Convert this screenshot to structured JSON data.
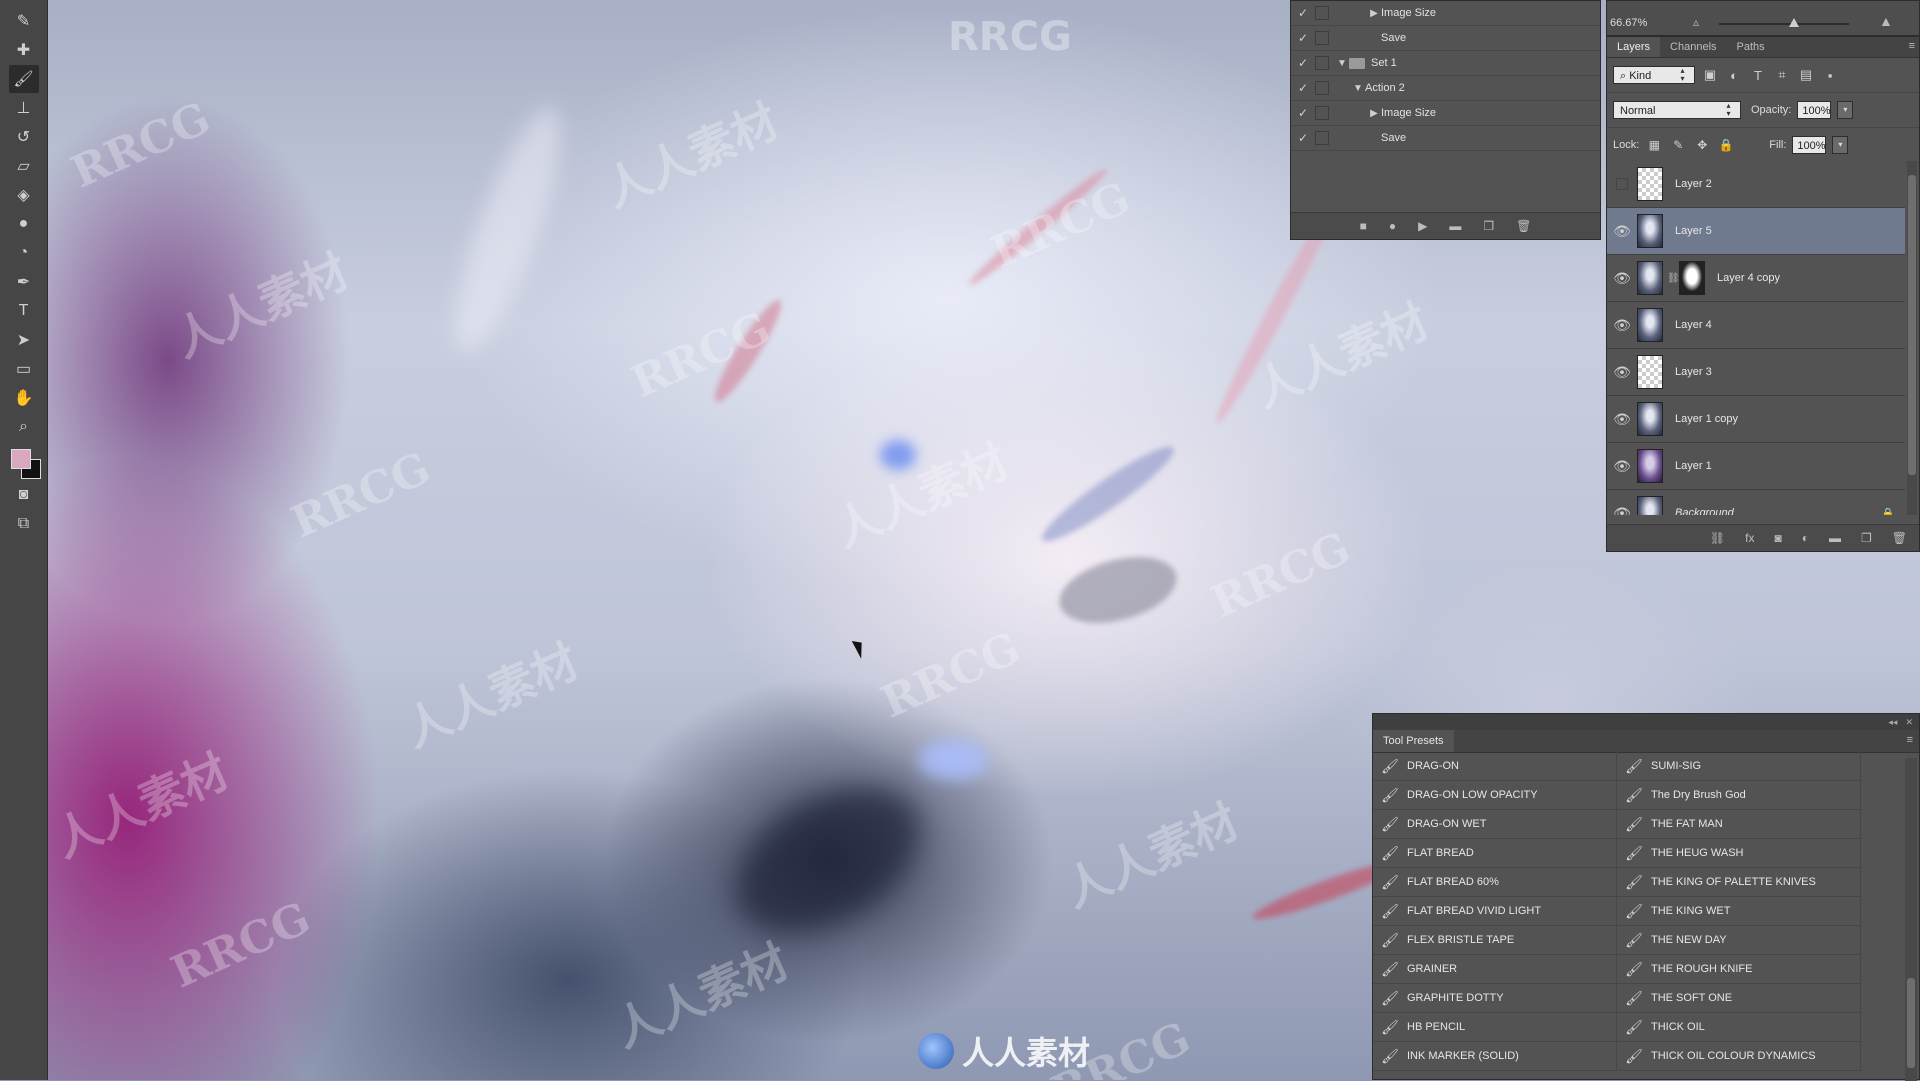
{
  "app": {
    "zoom_level": "66.67%"
  },
  "watermarks": {
    "top_text": "RRCG",
    "repeat_latin": "RRCG",
    "repeat_cn": "人人素材",
    "bottom_text": "人人素材"
  },
  "toolbar": {
    "tools": [
      {
        "name": "eyedropper-tool-icon",
        "glyph": "✎"
      },
      {
        "name": "healing-brush-tool-icon",
        "glyph": "✚"
      },
      {
        "name": "brush-tool-icon",
        "glyph": "🖌",
        "active": true
      },
      {
        "name": "clone-stamp-tool-icon",
        "glyph": "⊥"
      },
      {
        "name": "history-brush-tool-icon",
        "glyph": "↺"
      },
      {
        "name": "eraser-tool-icon",
        "glyph": "▱"
      },
      {
        "name": "paint-bucket-tool-icon",
        "glyph": "◈"
      },
      {
        "name": "blur-tool-icon",
        "glyph": "●"
      },
      {
        "name": "dodge-tool-icon",
        "glyph": "◔"
      },
      {
        "name": "pen-tool-icon",
        "glyph": "✒"
      },
      {
        "name": "type-tool-icon",
        "glyph": "T"
      },
      {
        "name": "path-selection-tool-icon",
        "glyph": "➤"
      },
      {
        "name": "rectangle-tool-icon",
        "glyph": "▭"
      },
      {
        "name": "hand-tool-icon",
        "glyph": "✋"
      },
      {
        "name": "zoom-tool-icon",
        "glyph": "⌕"
      }
    ],
    "foreground_color": "#d9a7bf",
    "background_color": "#111111",
    "bottom_tools": [
      {
        "name": "quick-mask-icon",
        "glyph": "◙"
      },
      {
        "name": "screen-mode-icon",
        "glyph": "⧉"
      }
    ]
  },
  "actions_panel": {
    "rows": [
      {
        "indent": 2,
        "triangle": "▶",
        "folder": false,
        "label": "Image Size"
      },
      {
        "indent": 2,
        "triangle": "",
        "folder": false,
        "label": "Save"
      },
      {
        "indent": 0,
        "triangle": "▼",
        "folder": true,
        "label": "Set 1"
      },
      {
        "indent": 1,
        "triangle": "▼",
        "folder": false,
        "label": "Action 2"
      },
      {
        "indent": 2,
        "triangle": "▶",
        "folder": false,
        "label": "Image Size"
      },
      {
        "indent": 2,
        "triangle": "",
        "folder": false,
        "label": "Save"
      }
    ],
    "footer_icons": [
      "stop-icon",
      "record-icon",
      "play-icon",
      "new-set-icon",
      "new-action-icon",
      "delete-icon"
    ]
  },
  "layers_panel": {
    "tabs": [
      "Layers",
      "Channels",
      "Paths"
    ],
    "active_tab": "Layers",
    "filter_kind": "Kind",
    "blend_mode": "Normal",
    "opacity_label": "Opacity:",
    "opacity_value": "100%",
    "lock_label": "Lock:",
    "fill_label": "Fill:",
    "fill_value": "100%",
    "layers": [
      {
        "name": "Layer 2",
        "visible": false,
        "thumb": "trans",
        "selected": false,
        "mask": false,
        "italic": false,
        "locked": false
      },
      {
        "name": "Layer 5",
        "visible": true,
        "thumb": "paint",
        "selected": true,
        "mask": false,
        "italic": false,
        "locked": false
      },
      {
        "name": "Layer 4 copy",
        "visible": true,
        "thumb": "paint",
        "selected": false,
        "mask": true,
        "italic": false,
        "locked": false
      },
      {
        "name": "Layer 4",
        "visible": true,
        "thumb": "paint",
        "selected": false,
        "mask": false,
        "italic": false,
        "locked": false
      },
      {
        "name": "Layer 3",
        "visible": true,
        "thumb": "trans",
        "selected": false,
        "mask": false,
        "italic": false,
        "locked": false
      },
      {
        "name": "Layer 1 copy",
        "visible": true,
        "thumb": "paint",
        "selected": false,
        "mask": false,
        "italic": false,
        "locked": false
      },
      {
        "name": "Layer 1",
        "visible": true,
        "thumb": "purple",
        "selected": false,
        "mask": false,
        "italic": false,
        "locked": false
      },
      {
        "name": "Background",
        "visible": true,
        "thumb": "paint",
        "selected": false,
        "mask": false,
        "italic": true,
        "locked": true
      }
    ],
    "footer_icons": [
      "link-layers-icon",
      "fx-icon",
      "add-mask-icon",
      "adjustment-layer-icon",
      "new-group-icon",
      "new-layer-icon",
      "delete-layer-icon"
    ]
  },
  "tool_presets_panel": {
    "title": "Tool Presets",
    "presets": [
      "DRAG-ON",
      "SUMI-SIG",
      "DRAG-ON LOW OPACITY",
      "The Dry Brush God",
      "DRAG-ON WET",
      "THE FAT MAN",
      "FLAT BREAD",
      "THE HEUG WASH",
      "FLAT BREAD 60%",
      "THE KING OF PALETTE KNIVES",
      "FLAT BREAD VIVID LIGHT",
      "THE KING WET",
      "FLEX BRISTLE TAPE",
      "THE NEW DAY",
      "GRAINER",
      "THE ROUGH KNIFE",
      "GRAPHITE DOTTY",
      "THE SOFT ONE",
      "HB PENCIL",
      "THICK OIL",
      "INK MARKER (SOLID)",
      "THICK OIL COLOUR DYNAMICS"
    ]
  }
}
